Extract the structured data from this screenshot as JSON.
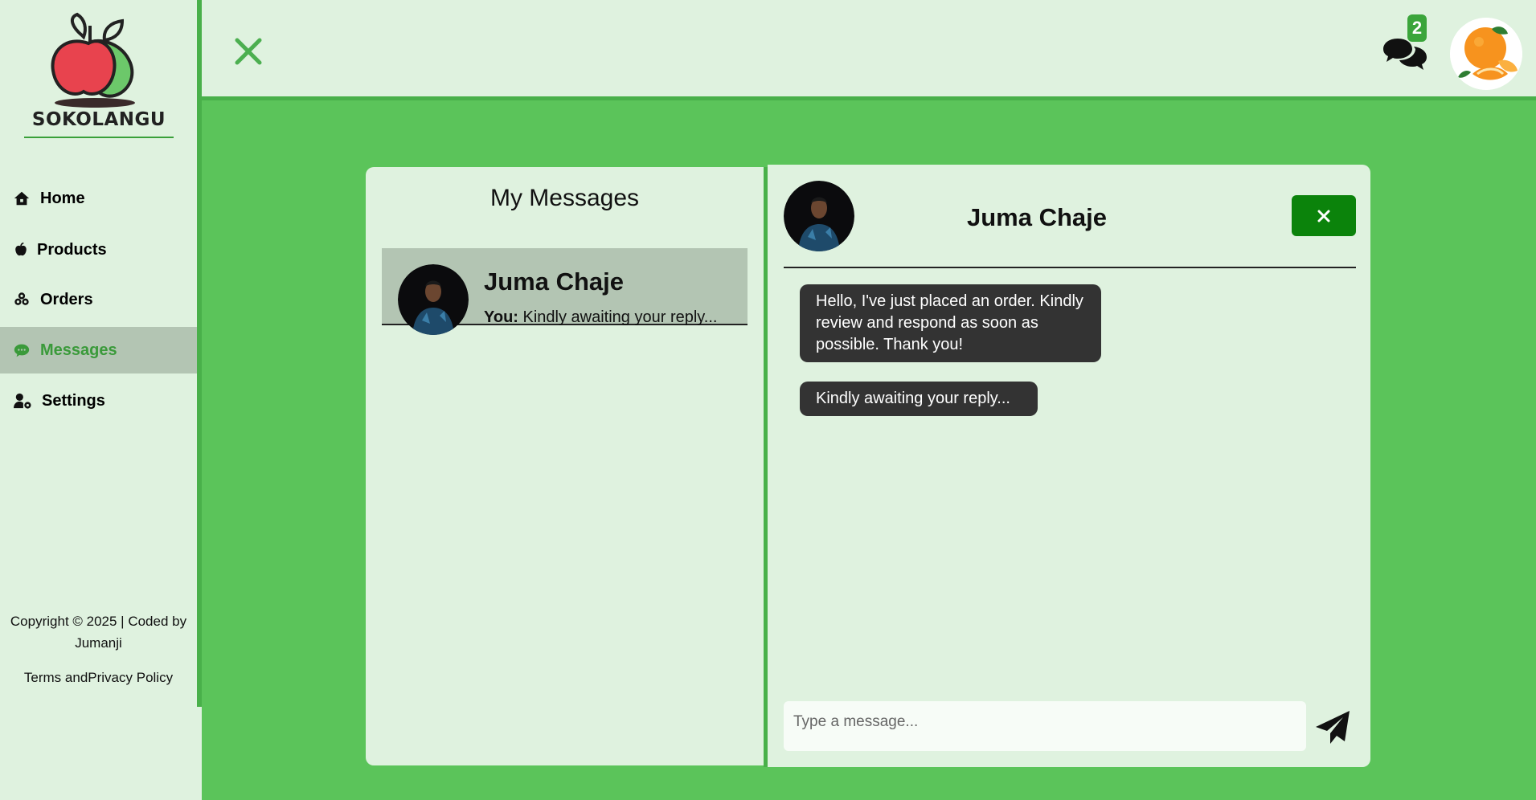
{
  "brand": {
    "name": "SOKOLANGU"
  },
  "sidebar": {
    "items": [
      {
        "label": "Home",
        "icon": "home-icon"
      },
      {
        "label": "Products",
        "icon": "apple-icon"
      },
      {
        "label": "Orders",
        "icon": "boxes-icon"
      },
      {
        "label": "Messages",
        "icon": "chat-icon",
        "active": true
      },
      {
        "label": "Settings",
        "icon": "user-gear-icon"
      }
    ],
    "footer": {
      "copyright": "Copyright © 2025 | Coded by Jumanji",
      "links": "Terms andPrivacy Policy"
    }
  },
  "topbar": {
    "notification_count": "2"
  },
  "messages": {
    "title": "My Messages",
    "conversations": [
      {
        "name": "Juma Chaje",
        "preview_prefix": "You:",
        "preview": "Kindly awaiting your reply..."
      }
    ]
  },
  "chat": {
    "contact_name": "Juma Chaje",
    "messages": [
      "Hello, I've just placed an order. Kindly review and respond as soon as possible. Thank you!",
      "Kindly awaiting your reply..."
    ],
    "input_placeholder": "Type a message..."
  },
  "colors": {
    "accent": "#5bc45a",
    "panel": "#dff2df",
    "close_button": "#0b830b",
    "bubble": "#333333"
  }
}
